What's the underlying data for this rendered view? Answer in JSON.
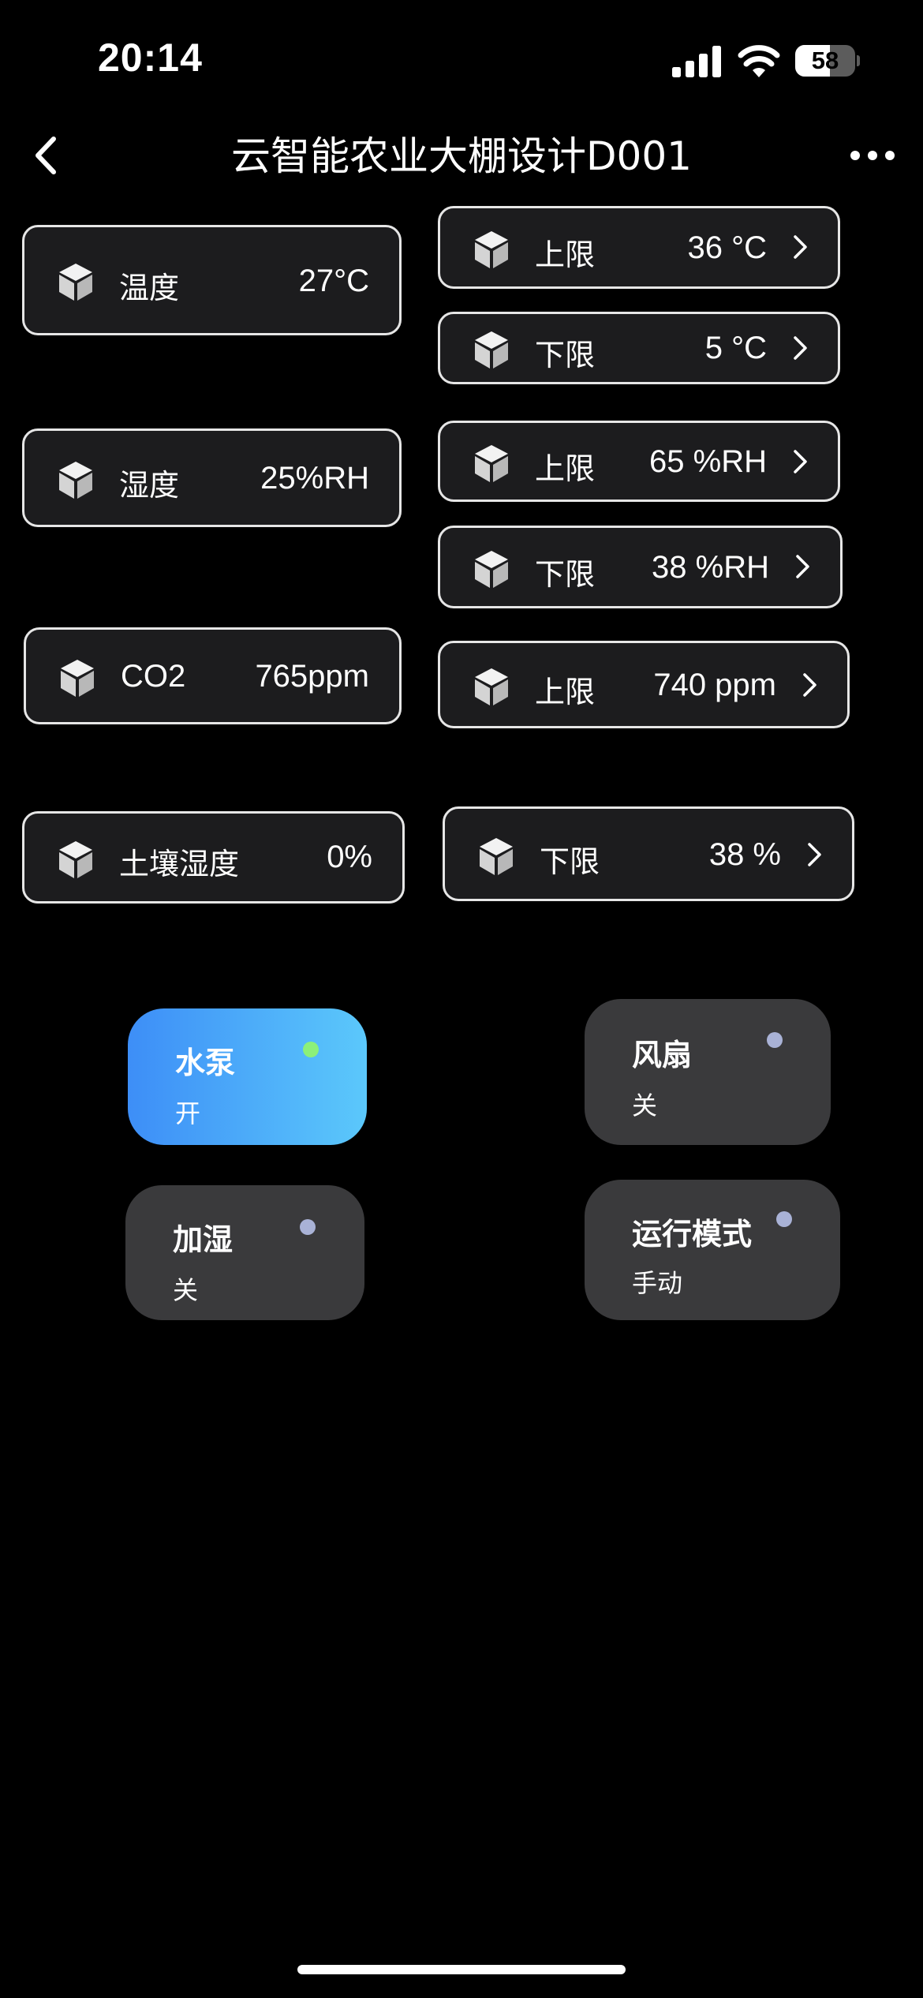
{
  "status_bar": {
    "time": "20:14",
    "battery_level": 58,
    "battery_text": "58"
  },
  "nav": {
    "title": "云智能农业大棚设计D001",
    "back_icon": "chevron-left-icon",
    "more_icon": "more-horizontal-icon"
  },
  "sensors": {
    "temperature": {
      "label": "温度",
      "value": "27°C"
    },
    "humidity": {
      "label": "湿度",
      "value": "25%RH"
    },
    "co2": {
      "label": "CO2",
      "value": "765ppm"
    },
    "soil": {
      "label": "土壤湿度",
      "value": "0%"
    }
  },
  "limits": {
    "temp_upper": {
      "label": "上限",
      "value": "36 °C"
    },
    "temp_lower": {
      "label": "下限",
      "value": "5 °C"
    },
    "hum_upper": {
      "label": "上限",
      "value": "65 %RH"
    },
    "hum_lower": {
      "label": "下限",
      "value": "38 %RH"
    },
    "co2_upper": {
      "label": "上限",
      "value": "740 ppm"
    },
    "soil_lower": {
      "label": "下限",
      "value": "38 %"
    }
  },
  "controls": {
    "pump": {
      "name": "水泵",
      "state": "开",
      "on": true
    },
    "fan": {
      "name": "风扇",
      "state": "关",
      "on": false
    },
    "humidifier": {
      "name": "加湿",
      "state": "关",
      "on": false
    },
    "mode": {
      "name": "运行模式",
      "state": "手动",
      "on": false
    }
  },
  "colors": {
    "card_border": "#e6e6e6",
    "card_bg": "#1c1c1e",
    "tile_off": "#3a3a3c",
    "tile_on_start": "#3d8ef7",
    "tile_on_end": "#5bc8fb",
    "dot_on": "#8cf07a",
    "dot_off": "#a9b2d6"
  },
  "icons": {
    "sensor_icon": "cube-icon",
    "limit_arrow": "chevron-right-icon"
  }
}
